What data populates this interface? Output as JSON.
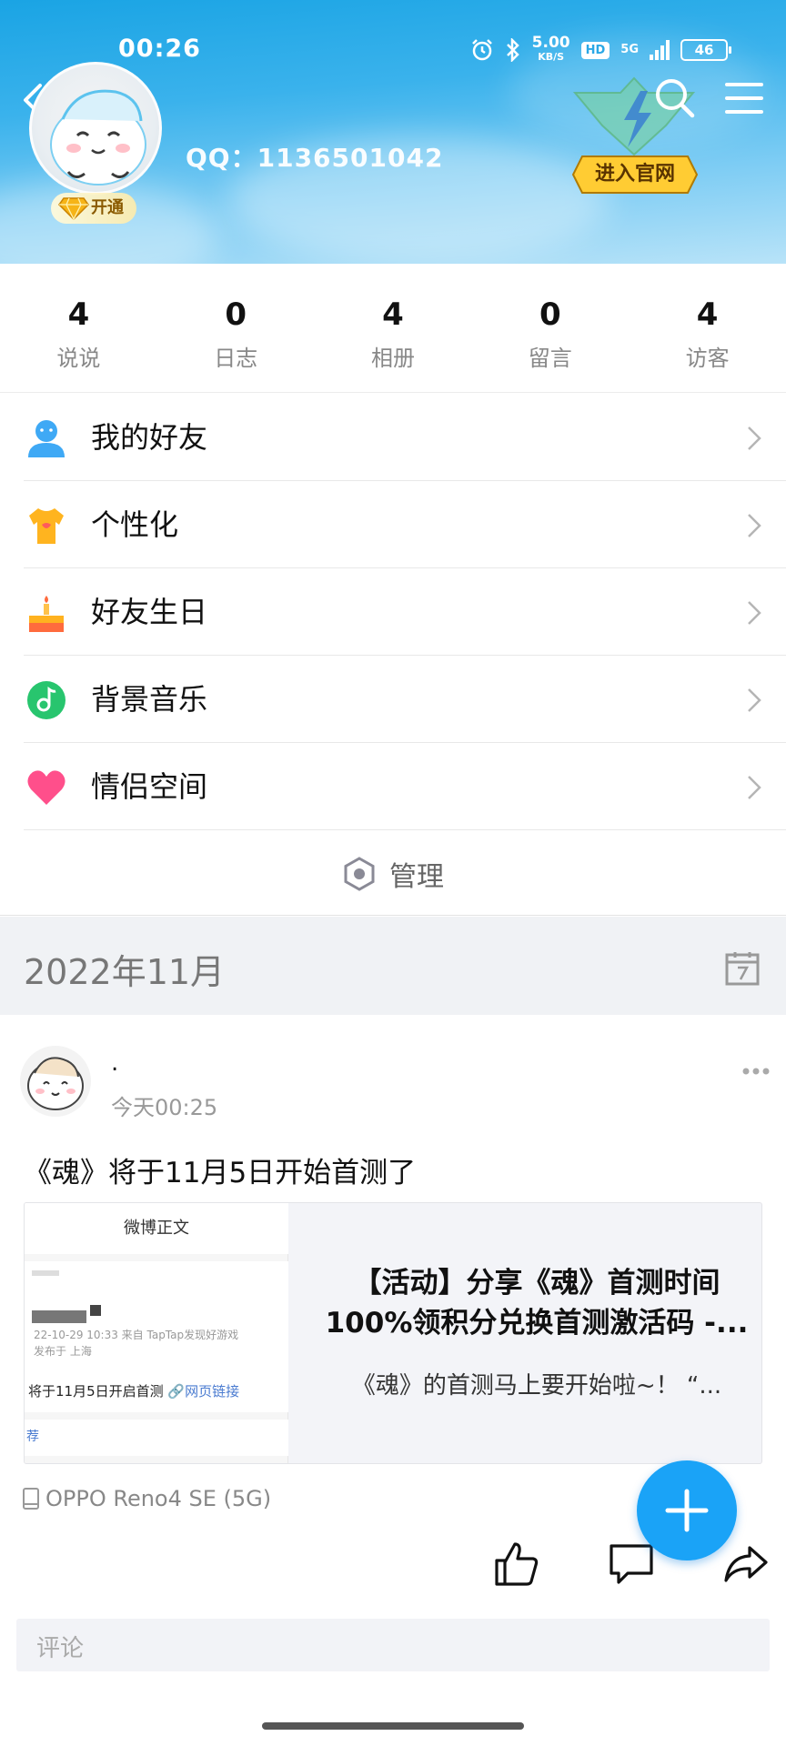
{
  "status_bar": {
    "time": "00:26",
    "net_speed": "5.00",
    "net_unit": "KB/S",
    "hd": "HD",
    "network": "5G",
    "battery": "46"
  },
  "profile": {
    "qq": "QQ：1136501042",
    "vip_label": "开通",
    "official_button": "进入官网"
  },
  "stats": [
    {
      "value": "4",
      "label": "说说"
    },
    {
      "value": "0",
      "label": "日志"
    },
    {
      "value": "4",
      "label": "相册"
    },
    {
      "value": "0",
      "label": "留言"
    },
    {
      "value": "4",
      "label": "访客"
    }
  ],
  "menu": [
    {
      "label": "我的好友",
      "icon": "friend-icon"
    },
    {
      "label": "个性化",
      "icon": "tshirt-icon"
    },
    {
      "label": "好友生日",
      "icon": "birthday-cake-icon"
    },
    {
      "label": "背景音乐",
      "icon": "music-note-icon"
    },
    {
      "label": "情侣空间",
      "icon": "heart-icon"
    }
  ],
  "manage": {
    "label": "管理"
  },
  "month": {
    "label": "2022年11月"
  },
  "post": {
    "author": ".",
    "time": "今天00:25",
    "text": "《魂》将于11月5日开始首测了",
    "card": {
      "thumb_header": "微博正文",
      "thumb_meta_1": "22-10-29 10:33  来自 TapTap发现好游戏",
      "thumb_meta_2": "发布于 上海",
      "thumb_line": "将于11月5日开启首测",
      "thumb_link": "网页链接",
      "thumb_foot": "荐",
      "title_1": "【活动】分享《魂》首测时间",
      "title_2": "100%领积分兑换首测激活码 -...",
      "subtitle": "《魂》的首测马上要开始啦~！ “..."
    },
    "device": "OPPO Reno4 SE (5G)",
    "comment_placeholder": "评论"
  },
  "colors": {
    "accent": "#1aa3f7",
    "header_top": "#1aa4e4",
    "month_bg": "#f0f2f5"
  }
}
